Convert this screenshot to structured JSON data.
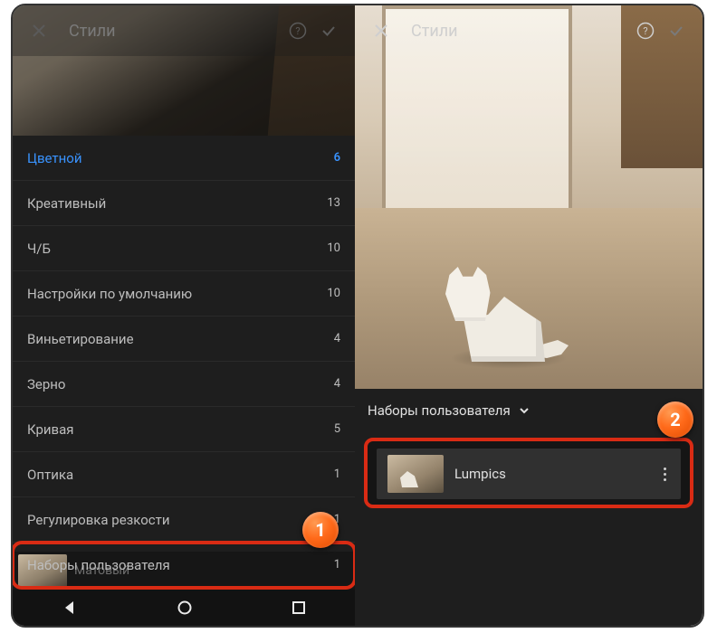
{
  "left": {
    "header_title": "Стили",
    "categories": [
      {
        "label": "Цветной",
        "count": "6",
        "active": true
      },
      {
        "label": "Креативный",
        "count": "13"
      },
      {
        "label": "Ч/Б",
        "count": "10"
      },
      {
        "label": "Настройки по умолчанию",
        "count": "10"
      },
      {
        "label": "Виньетирование",
        "count": "4"
      },
      {
        "label": "Зерно",
        "count": "4"
      },
      {
        "label": "Кривая",
        "count": "5"
      },
      {
        "label": "Оптика",
        "count": "1"
      },
      {
        "label": "Регулировка резкости",
        "count": "1"
      },
      {
        "label": "Наборы пользователя",
        "count": "1",
        "highlight": true
      }
    ],
    "thumb_label": "Матовый"
  },
  "right": {
    "header_title": "Стили",
    "section_label": "Наборы пользователя",
    "preset_name": "Lumpics"
  },
  "annotations": {
    "one": "1",
    "two": "2"
  }
}
